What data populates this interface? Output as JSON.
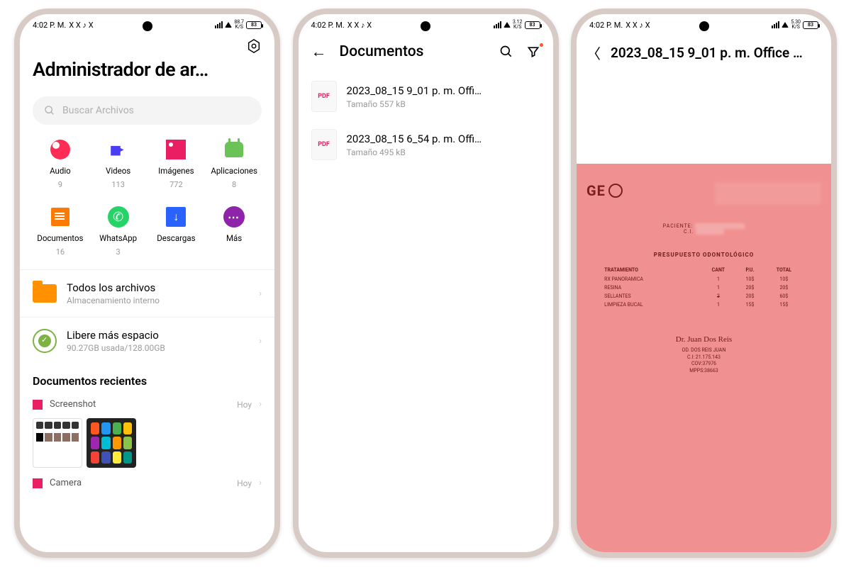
{
  "status": {
    "time": "4:02 P. M.",
    "icons": "X X ♪ X",
    "battery": "83",
    "net1": "88.7",
    "net2": "3.12",
    "net3": "5.30",
    "ks": "K/S"
  },
  "p1": {
    "title": "Administrador de ar…",
    "search_placeholder": "Buscar Archivos",
    "cats": [
      {
        "label": "Audio",
        "count": "9"
      },
      {
        "label": "Videos",
        "count": "113"
      },
      {
        "label": "Imágenes",
        "count": "772"
      },
      {
        "label": "Aplicaciones",
        "count": "8"
      },
      {
        "label": "Documentos",
        "count": "16"
      },
      {
        "label": "WhatsApp",
        "count": "3"
      },
      {
        "label": "Descargas",
        "count": ""
      },
      {
        "label": "Más",
        "count": ""
      }
    ],
    "all_files": {
      "title": "Todos los archivos",
      "sub": "Almacenamiento interno"
    },
    "free": {
      "title": "Libere más espacio",
      "sub": "90.27GB usada/128.00GB"
    },
    "recents_title": "Documentos recientes",
    "rec": [
      {
        "name": "Screenshot",
        "date": "Hoy"
      },
      {
        "name": "Camera",
        "date": "Hoy"
      }
    ]
  },
  "p2": {
    "title": "Documentos",
    "items": [
      {
        "name": "2023_08_15 9_01 p. m. Offi…",
        "size": "Tamaño 557 kB"
      },
      {
        "name": "2023_08_15 6_54 p. m. Offi…",
        "size": "Tamaño 495 kB"
      }
    ]
  },
  "p3": {
    "title": "2023_08_15 9_01 p. m. Office …",
    "doc": {
      "logo": "GE",
      "paciente_label": "PACIENTE:",
      "ci_label": "C.I.",
      "heading": "PRESUPUESTO ODONTOLÓGICO",
      "cols": [
        "TRATAMIENTO",
        "CANT",
        "P.U.",
        "TOTAL"
      ],
      "rows": [
        [
          "RX PANORAMICA",
          "1",
          "10$",
          "10$"
        ],
        [
          "RESINA",
          "1",
          "20$",
          "20$"
        ],
        [
          "SELLANTES",
          "3",
          "20$",
          "60$"
        ],
        [
          "LIMPIEZA BUCAL",
          "1",
          "15$",
          "15$"
        ]
      ],
      "dentist": {
        "name": "OD. DOS REIS JUAN",
        "ci": "C.I: 21.175.143",
        "cov": "COV:37976",
        "mpps": "MPPS:38663"
      }
    }
  }
}
